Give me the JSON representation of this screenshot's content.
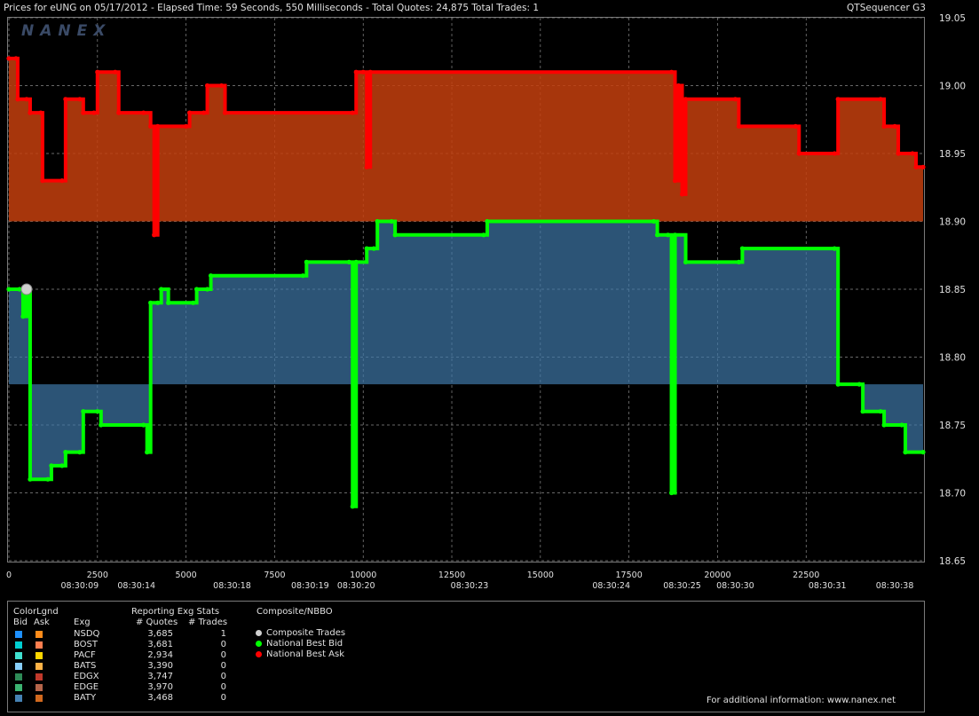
{
  "header": {
    "title": "Prices for  eUNG  on  05/17/2012  -  Elapsed Time: 59 Seconds, 550 Milliseconds  -  Total Quotes: 24,875  Total Trades: 1",
    "product": "QTSequencer G3"
  },
  "logo_text": "NANEX",
  "chart_data": {
    "type": "line",
    "title": "Prices for eUNG on 05/17/2012",
    "ylim": [
      18.65,
      19.05
    ],
    "xlim": [
      0,
      25800
    ],
    "y_ticks": [
      "19.05",
      "19.00",
      "18.95",
      "18.90",
      "18.85",
      "18.80",
      "18.75",
      "18.70",
      "18.65"
    ],
    "x_ticks": [
      {
        "v": 0,
        "label": "0"
      },
      {
        "v": 2500,
        "label": "2500"
      },
      {
        "v": 5000,
        "label": "5000"
      },
      {
        "v": 7500,
        "label": "7500"
      },
      {
        "v": 10000,
        "label": "10000"
      },
      {
        "v": 12500,
        "label": "12500"
      },
      {
        "v": 15000,
        "label": "15000"
      },
      {
        "v": 17500,
        "label": "17500"
      },
      {
        "v": 20000,
        "label": "20000"
      },
      {
        "v": 22500,
        "label": "22500"
      }
    ],
    "time_labels": [
      {
        "v": 2000,
        "label": "08:30:09"
      },
      {
        "v": 3600,
        "label": "08:30:14"
      },
      {
        "v": 6300,
        "label": "08:30:18"
      },
      {
        "v": 8500,
        "label": "08:30:19"
      },
      {
        "v": 9800,
        "label": "08:30:20"
      },
      {
        "v": 13000,
        "label": "08:30:23"
      },
      {
        "v": 17000,
        "label": "08:30:24"
      },
      {
        "v": 19000,
        "label": "08:30:25"
      },
      {
        "v": 20500,
        "label": "08:30:30"
      },
      {
        "v": 23100,
        "label": "08:30:31"
      },
      {
        "v": 25000,
        "label": "08:30:38"
      }
    ],
    "grid": true,
    "series": [
      {
        "name": "National Best Ask",
        "color": "#ff0000",
        "points": [
          [
            0,
            19.02
          ],
          [
            200,
            19.02
          ],
          [
            250,
            18.99
          ],
          [
            500,
            18.99
          ],
          [
            600,
            18.98
          ],
          [
            900,
            18.98
          ],
          [
            950,
            18.93
          ],
          [
            1500,
            18.93
          ],
          [
            1600,
            18.99
          ],
          [
            2000,
            18.99
          ],
          [
            2100,
            18.98
          ],
          [
            2400,
            18.98
          ],
          [
            2500,
            19.01
          ],
          [
            3000,
            19.01
          ],
          [
            3100,
            18.98
          ],
          [
            3800,
            18.98
          ],
          [
            4000,
            18.97
          ],
          [
            4100,
            18.89
          ],
          [
            4200,
            18.97
          ],
          [
            5000,
            18.97
          ],
          [
            5100,
            18.98
          ],
          [
            5500,
            18.98
          ],
          [
            5600,
            19.0
          ],
          [
            6000,
            19.0
          ],
          [
            6100,
            18.98
          ],
          [
            9700,
            18.98
          ],
          [
            9800,
            19.01
          ],
          [
            10000,
            19.01
          ],
          [
            10100,
            18.94
          ],
          [
            10200,
            19.01
          ],
          [
            18700,
            19.01
          ],
          [
            18800,
            18.93
          ],
          [
            18900,
            19.0
          ],
          [
            19000,
            18.92
          ],
          [
            19100,
            18.99
          ],
          [
            20500,
            18.99
          ],
          [
            20600,
            18.97
          ],
          [
            22200,
            18.97
          ],
          [
            22300,
            18.95
          ],
          [
            23300,
            18.95
          ],
          [
            23400,
            18.99
          ],
          [
            24600,
            18.99
          ],
          [
            24700,
            18.97
          ],
          [
            25000,
            18.97
          ],
          [
            25100,
            18.95
          ],
          [
            25500,
            18.95
          ],
          [
            25600,
            18.94
          ],
          [
            25800,
            18.94
          ]
        ]
      },
      {
        "name": "National Best Bid",
        "color": "#00ff00",
        "points": [
          [
            0,
            18.85
          ],
          [
            300,
            18.85
          ],
          [
            400,
            18.83
          ],
          [
            500,
            18.85
          ],
          [
            600,
            18.71
          ],
          [
            1100,
            18.71
          ],
          [
            1200,
            18.72
          ],
          [
            1500,
            18.72
          ],
          [
            1600,
            18.73
          ],
          [
            2000,
            18.73
          ],
          [
            2100,
            18.76
          ],
          [
            2500,
            18.76
          ],
          [
            2600,
            18.75
          ],
          [
            3800,
            18.75
          ],
          [
            3900,
            18.73
          ],
          [
            4000,
            18.84
          ],
          [
            4200,
            18.84
          ],
          [
            4300,
            18.85
          ],
          [
            4500,
            18.84
          ],
          [
            5200,
            18.84
          ],
          [
            5300,
            18.85
          ],
          [
            5600,
            18.85
          ],
          [
            5700,
            18.86
          ],
          [
            8300,
            18.86
          ],
          [
            8400,
            18.87
          ],
          [
            9600,
            18.87
          ],
          [
            9700,
            18.69
          ],
          [
            9800,
            18.87
          ],
          [
            10100,
            18.88
          ],
          [
            10300,
            18.88
          ],
          [
            10400,
            18.9
          ],
          [
            10800,
            18.9
          ],
          [
            10900,
            18.89
          ],
          [
            13400,
            18.89
          ],
          [
            13500,
            18.9
          ],
          [
            18200,
            18.9
          ],
          [
            18300,
            18.89
          ],
          [
            18600,
            18.89
          ],
          [
            18700,
            18.7
          ],
          [
            18800,
            18.89
          ],
          [
            19100,
            18.87
          ],
          [
            20600,
            18.87
          ],
          [
            20700,
            18.88
          ],
          [
            23300,
            18.88
          ],
          [
            23400,
            18.78
          ],
          [
            24000,
            18.78
          ],
          [
            24100,
            18.76
          ],
          [
            24600,
            18.76
          ],
          [
            24700,
            18.75
          ],
          [
            25200,
            18.75
          ],
          [
            25300,
            18.73
          ],
          [
            25800,
            18.73
          ]
        ]
      }
    ],
    "trades": [
      [
        500,
        18.85
      ]
    ]
  },
  "legend": {
    "color_legend_title": "ColorLgnd",
    "bid_label": "Bid",
    "ask_label": "Ask",
    "stats_title": "Reporting Exg Stats",
    "exg_header": "Exg",
    "quotes_header": "# Quotes",
    "trades_header": "# Trades",
    "exchanges": [
      {
        "exg": "NSDQ",
        "quotes": "3,685",
        "trades": "1",
        "bid_color": "#1e90ff",
        "ask_color": "#ff8c1a"
      },
      {
        "exg": "BOST",
        "quotes": "3,681",
        "trades": "0",
        "bid_color": "#00ced1",
        "ask_color": "#ff7f50"
      },
      {
        "exg": "PACF",
        "quotes": "2,934",
        "trades": "0",
        "bid_color": "#40e0d0",
        "ask_color": "#ffd700"
      },
      {
        "exg": "BATS",
        "quotes": "3,390",
        "trades": "0",
        "bid_color": "#87cefa",
        "ask_color": "#ffb347"
      },
      {
        "exg": "EDGX",
        "quotes": "3,747",
        "trades": "0",
        "bid_color": "#2e8b57",
        "ask_color": "#c0392b"
      },
      {
        "exg": "EDGE",
        "quotes": "3,970",
        "trades": "0",
        "bid_color": "#3cb371",
        "ask_color": "#b5654a"
      },
      {
        "exg": "BATY",
        "quotes": "3,468",
        "trades": "0",
        "bid_color": "#4682b4",
        "ask_color": "#d2691e"
      }
    ],
    "composite_title": "Composite/NBBO",
    "composite_items": [
      {
        "label": "Composite Trades",
        "color": "#d0d0d0"
      },
      {
        "label": "National Best Bid",
        "color": "#00ff00"
      },
      {
        "label": "National Best Ask",
        "color": "#ff0000"
      }
    ]
  },
  "footer_note": "For additional information: www.nanex.net"
}
